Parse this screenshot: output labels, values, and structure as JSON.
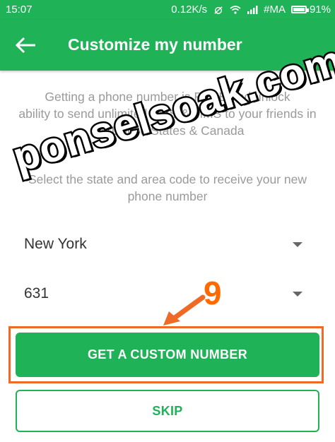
{
  "status_bar": {
    "time": "15:07",
    "network_speed": "0.12K/s",
    "carrier": "#MA",
    "battery": "91%",
    "icons": [
      "alarm-off-icon",
      "wifi-icon",
      "signal-icon",
      "battery-icon"
    ]
  },
  "app_bar": {
    "title": "Customize my number",
    "back_icon": "arrow-left-icon"
  },
  "content": {
    "intro_lines": [
      "Getting a phone number is FREE and unlock",
      "ability to send unlimited SMS & MMS to your friends in",
      "the United States & Canada"
    ],
    "instruction_lines": [
      "Select the state and area code to receive your new",
      "phone number"
    ]
  },
  "form": {
    "state_value": "New York",
    "area_code_value": "631"
  },
  "buttons": {
    "primary": "GET A CUSTOM NUMBER",
    "skip": "SKIP"
  },
  "overlay": {
    "watermark": "ponselsoak.com",
    "step_number": "9"
  },
  "colors": {
    "brand_green": "#1fb257",
    "annotation_orange": "#ef6a24",
    "muted_text": "#9a9a9a"
  }
}
